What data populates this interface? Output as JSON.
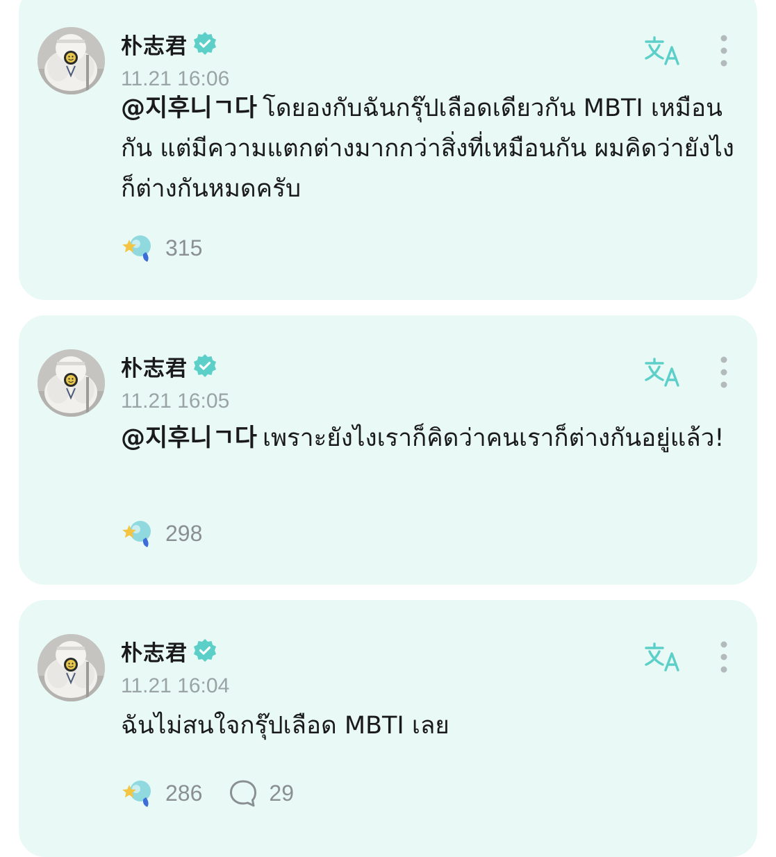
{
  "colors": {
    "card_bg": "#e8f9f6",
    "accent": "#5dcfc9",
    "text": "#1a1a1a",
    "muted": "#9aa3a6"
  },
  "icons": {
    "verified": "verified-badge-icon",
    "translate": "translate-icon",
    "more": "more-vertical-icon",
    "reaction": "star-heart-reaction-icon",
    "comment": "comment-bubble-icon"
  },
  "posts": [
    {
      "author": "朴志君",
      "time": "11.21 16:06",
      "mention": "@지후니ㄱ다",
      "text": "โดยองกับฉันกรุ๊ปเลือดเดียวกัน MBTI เหมือนกัน แต่มีความแตกต่างมากกว่าสิ่งที่เหมือนกัน ผมคิดว่ายังไงก็ต่างกันหมดครับ",
      "reactions": "315"
    },
    {
      "author": "朴志君",
      "time": "11.21 16:05",
      "mention": "@지후니ㄱ다",
      "text": "เพราะยังไงเราก็คิดว่าคนเราก็ต่างกันอยู่แล้ว!",
      "reactions": "298"
    },
    {
      "author": "朴志君",
      "time": "11.21 16:04",
      "mention": "",
      "text": "ฉันไม่สนใจกรุ๊ปเลือด MBTI เลย",
      "reactions": "286",
      "comments": "29"
    }
  ]
}
